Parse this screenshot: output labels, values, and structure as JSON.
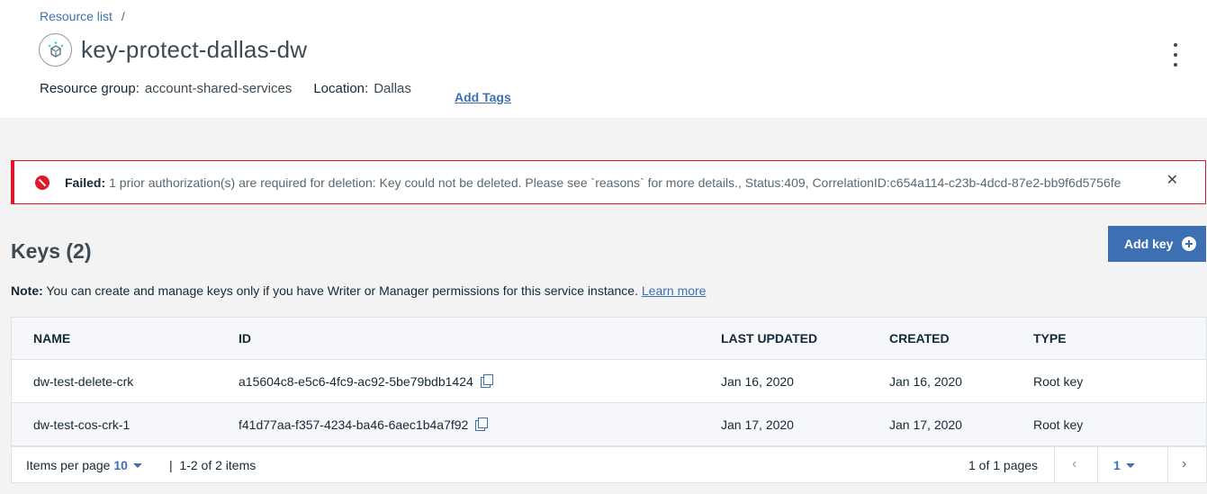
{
  "breadcrumb": {
    "link": "Resource list",
    "separator": "/"
  },
  "header": {
    "title": "key-protect-dallas-dw",
    "resource_group_label": "Resource group:",
    "resource_group_value": "account-shared-services",
    "location_label": "Location:",
    "location_value": "Dallas",
    "add_tags": "Add Tags"
  },
  "alert": {
    "strong": "Failed:",
    "message": "1 prior authorization(s) are required for deletion: Key could not be deleted. Please see `reasons` for more details., Status:409, CorrelationID:c654a114-c23b-4dcd-87e2-bb9f6d5756fe",
    "close": "✕"
  },
  "keys": {
    "title": "Keys (2)",
    "add_button": "Add key",
    "note_label": "Note:",
    "note_text": "You can create and manage keys only if you have Writer or Manager permissions for this service instance.",
    "learn_more": "Learn more"
  },
  "table": {
    "headers": {
      "name": "NAME",
      "id": "ID",
      "last_updated": "LAST UPDATED",
      "created": "CREATED",
      "type": "TYPE"
    },
    "rows": [
      {
        "name": "dw-test-delete-crk",
        "id": "a15604c8-e5c6-4fc9-ac92-5be79bdb1424",
        "last_updated": "Jan 16, 2020",
        "created": "Jan 16, 2020",
        "type": "Root key"
      },
      {
        "name": "dw-test-cos-crk-1",
        "id": "f41d77aa-f357-4234-ba46-6aec1b4a7f92",
        "last_updated": "Jan 17, 2020",
        "created": "Jan 17, 2020",
        "type": "Root key"
      }
    ]
  },
  "pagination": {
    "items_per_page_label": "Items per page",
    "items_per_page_value": "10",
    "range": "|  1-2 of 2 items",
    "pages": "1 of 1 pages",
    "current_page": "1",
    "prev": "‹",
    "next": "›"
  },
  "colors": {
    "primary": "#3d70b2",
    "error": "#e0182d"
  },
  "icons": {
    "service": "key-protect-icon",
    "alert": "error-icon",
    "copy": "copy-icon",
    "menu": "overflow-menu-icon"
  }
}
